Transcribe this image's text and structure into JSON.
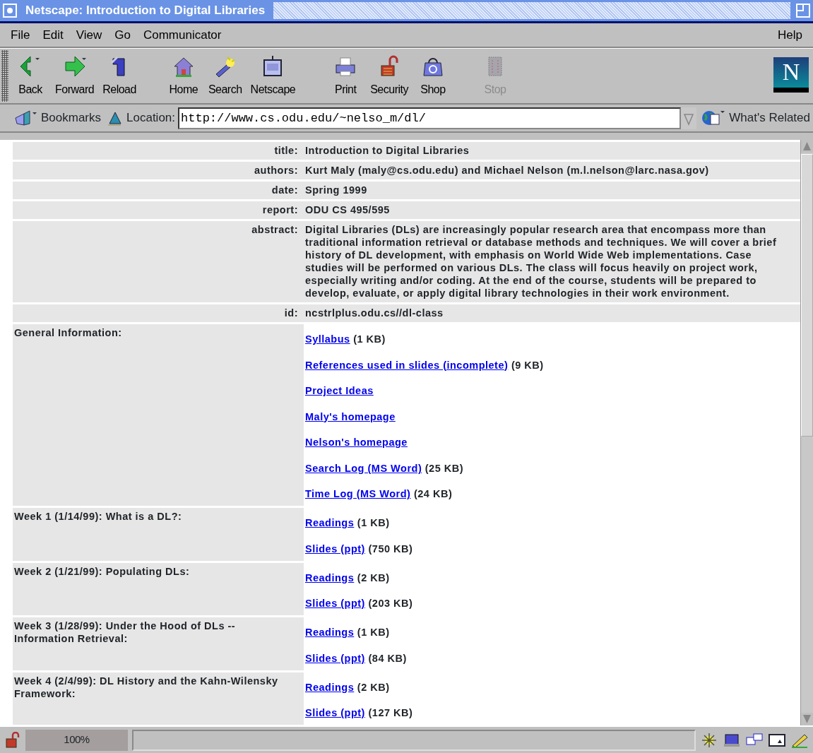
{
  "window": {
    "title": "Netscape: Introduction to Digital Libraries"
  },
  "menu": [
    "File",
    "Edit",
    "View",
    "Go",
    "Communicator"
  ],
  "help_menu": "Help",
  "toolbar": [
    {
      "label": "Back",
      "disabled": false
    },
    {
      "label": "Forward",
      "disabled": false
    },
    {
      "label": "Reload",
      "disabled": false
    },
    {
      "label": "Home",
      "disabled": false
    },
    {
      "label": "Search",
      "disabled": false
    },
    {
      "label": "Netscape",
      "disabled": false
    },
    {
      "label": "Print",
      "disabled": false
    },
    {
      "label": "Security",
      "disabled": false
    },
    {
      "label": "Shop",
      "disabled": false
    },
    {
      "label": "Stop",
      "disabled": true
    }
  ],
  "logo": "N",
  "location_bar": {
    "bookmarks": "Bookmarks",
    "location_label": "Location:",
    "url": "http://www.cs.odu.edu/~nelso_m/dl/",
    "whats_related": "What's Related"
  },
  "record": [
    {
      "label": "title:",
      "value": "Introduction to Digital Libraries"
    },
    {
      "label": "authors:",
      "value": "Kurt Maly (maly@cs.odu.edu) and Michael Nelson (m.l.nelson@larc.nasa.gov)"
    },
    {
      "label": "date:",
      "value": "Spring 1999"
    },
    {
      "label": "report:",
      "value": "ODU CS 495/595"
    },
    {
      "label": "abstract:",
      "value": "Digital Libraries (DLs) are increasingly popular research area that encompass more than traditional information retrieval or database methods and techniques. We will cover a brief history of DL development, with emphasis on World Wide Web implementations. Case studies will be performed on various DLs. The class will focus heavily on project work, especially writing and/or coding. At the end of the course, students will be prepared to develop, evaluate, or apply digital library technologies in their work environment."
    },
    {
      "label": "id:",
      "value": "ncstrlplus.odu.cs//dl-class"
    }
  ],
  "sections": [
    {
      "heading": "General Information:",
      "links": [
        {
          "text": "Syllabus",
          "size": "(1 KB)"
        },
        {
          "text": "References used in slides (incomplete)",
          "size": "(9 KB)"
        },
        {
          "text": "Project Ideas"
        },
        {
          "text": "Maly's homepage"
        },
        {
          "text": "Nelson's homepage"
        },
        {
          "text": "Search Log (MS Word)",
          "size": "(25 KB)"
        },
        {
          "text": "Time Log (MS Word)",
          "size": "(24 KB)"
        }
      ]
    },
    {
      "heading": "Week 1 (1/14/99): What is a DL?:",
      "links": [
        {
          "text": "Readings",
          "size": "(1 KB)"
        },
        {
          "text": "Slides (ppt)",
          "size": "(750 KB)"
        }
      ]
    },
    {
      "heading": "Week 2 (1/21/99): Populating DLs:",
      "links": [
        {
          "text": "Readings",
          "size": "(2 KB)"
        },
        {
          "text": "Slides (ppt)",
          "size": "(203 KB)"
        }
      ]
    },
    {
      "heading": "Week 3 (1/28/99): Under the Hood of DLs -- Information Retrieval:",
      "links": [
        {
          "text": "Readings",
          "size": "(1 KB)"
        },
        {
          "text": "Slides (ppt)",
          "size": "(84 KB)"
        }
      ]
    },
    {
      "heading": "Week 4 (2/4/99): DL History and the Kahn-Wilensky Framework:",
      "links": [
        {
          "text": "Readings",
          "size": "(2 KB)"
        },
        {
          "text": "Slides (ppt)",
          "size": "(127 KB)"
        }
      ]
    }
  ],
  "status_bar": {
    "zoom": "100%"
  }
}
